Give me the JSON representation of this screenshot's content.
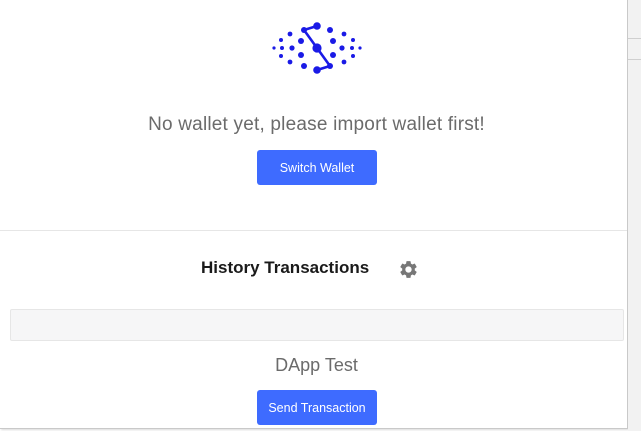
{
  "wallet": {
    "empty_message": "No wallet yet, please import wallet first!",
    "switch_button": "Switch Wallet"
  },
  "history": {
    "title": "History Transactions",
    "settings_icon": "gear-icon"
  },
  "dapp": {
    "title": "DApp Test",
    "send_button": "Send Transaction"
  },
  "icons": {
    "logo": "dotted-network-logo-icon"
  },
  "colors": {
    "accent": "#3e6bff",
    "logo": "#1a1ae6",
    "text_muted": "#6b6b6b",
    "gear": "#777777"
  }
}
